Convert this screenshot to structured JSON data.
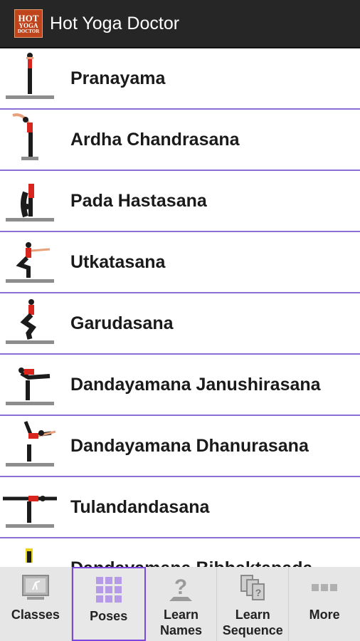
{
  "app_bar": {
    "title": "Hot Yoga Doctor",
    "logo_lines": [
      "HOT",
      "YOGA",
      "DOCTOR"
    ]
  },
  "poses": [
    {
      "name": "Pranayama",
      "icon": "yoga-pose-icon"
    },
    {
      "name": "Ardha Chandrasana",
      "icon": "yoga-pose-icon"
    },
    {
      "name": "Pada Hastasana",
      "icon": "yoga-pose-icon"
    },
    {
      "name": "Utkatasana",
      "icon": "yoga-pose-icon"
    },
    {
      "name": "Garudasana",
      "icon": "yoga-pose-icon"
    },
    {
      "name": "Dandayamana Janushirasana",
      "icon": "yoga-pose-icon"
    },
    {
      "name": "Dandayamana Dhanurasana",
      "icon": "yoga-pose-icon"
    },
    {
      "name": "Tulandandasana",
      "icon": "yoga-pose-icon"
    },
    {
      "name": "Dandayamana Bibhaktapada",
      "icon": "yoga-pose-icon"
    }
  ],
  "tabs": [
    {
      "label": "Classes",
      "icon": "classes-icon",
      "selected": false
    },
    {
      "label": "Poses",
      "icon": "grid-icon",
      "selected": true
    },
    {
      "label": "Learn\nNames",
      "icon": "question-icon",
      "selected": false
    },
    {
      "label": "Learn\nSequence",
      "icon": "cards-icon",
      "selected": false
    },
    {
      "label": "More",
      "icon": "more-icon",
      "selected": false
    }
  ],
  "colors": {
    "app_bar": "#262626",
    "divider": "#8a6fd6",
    "selected_tab": "#7b47e0",
    "logo": "#c0441b"
  }
}
